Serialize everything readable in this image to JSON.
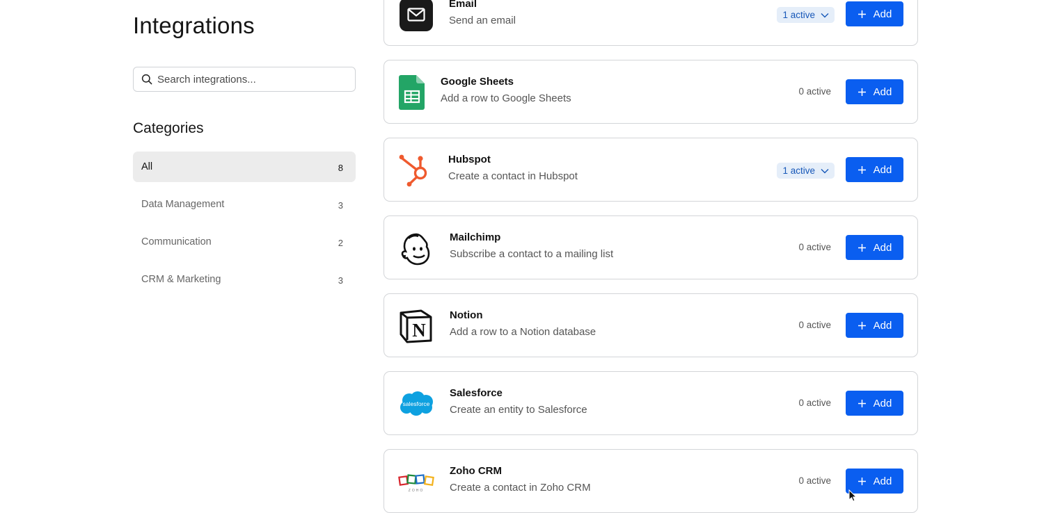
{
  "page": {
    "title": "Integrations"
  },
  "search": {
    "placeholder": "Search integrations...",
    "value": ""
  },
  "categories": {
    "heading": "Categories",
    "items": [
      {
        "label": "All",
        "count": "8",
        "selected": true
      },
      {
        "label": "Data Management",
        "count": "3",
        "selected": false
      },
      {
        "label": "Communication",
        "count": "2",
        "selected": false
      },
      {
        "label": "CRM & Marketing",
        "count": "3",
        "selected": false
      }
    ]
  },
  "integrations": [
    {
      "name": "Email",
      "description": "Send an email",
      "active": "1 active",
      "active_dropdown": true,
      "add_label": "Add",
      "icon": "email-icon"
    },
    {
      "name": "Google Sheets",
      "description": "Add a row to Google Sheets",
      "active": "0 active",
      "active_dropdown": false,
      "add_label": "Add",
      "icon": "google-sheets-icon"
    },
    {
      "name": "Hubspot",
      "description": "Create a contact in Hubspot",
      "active": "1 active",
      "active_dropdown": true,
      "add_label": "Add",
      "icon": "hubspot-icon"
    },
    {
      "name": "Mailchimp",
      "description": "Subscribe a contact to a mailing list",
      "active": "0 active",
      "active_dropdown": false,
      "add_label": "Add",
      "icon": "mailchimp-icon"
    },
    {
      "name": "Notion",
      "description": "Add a row to a Notion database",
      "active": "0 active",
      "active_dropdown": false,
      "add_label": "Add",
      "icon": "notion-icon"
    },
    {
      "name": "Salesforce",
      "description": "Create an entity to Salesforce",
      "active": "0 active",
      "active_dropdown": false,
      "add_label": "Add",
      "icon": "salesforce-icon",
      "logo_text": "salesforce"
    },
    {
      "name": "Zoho CRM",
      "description": "Create a contact in Zoho CRM",
      "active": "0 active",
      "active_dropdown": false,
      "add_label": "Add",
      "icon": "zoho-icon",
      "logo_text": "ZOHO"
    }
  ],
  "colors": {
    "primary": "#0a5ef0",
    "active_pill_bg": "#e5eef9",
    "active_pill_text": "#1657b8",
    "selected_category_bg": "#ececec"
  }
}
